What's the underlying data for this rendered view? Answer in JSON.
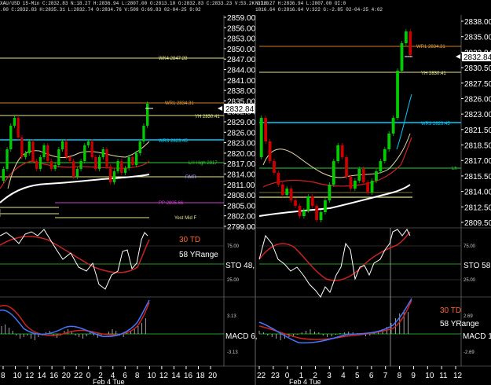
{
  "header": {
    "left_line1": "XAU/USD 15-Min C:2832.83 N:18.27 H:2836.94 L:2807.00 O:2813.10 O:2832.83 C:2833.23 V:53.2K OI:0",
    "left_line2": ".00 C:2832.83 H:2835.31 L:2832.74 O:2834.76 V:509 G:69.83 02-04-25 9:02",
    "right_line1": "N:18.27 H:2836.94 L:2807.00 OI:0",
    "right_line2": "1816.64 O:2816.64 V:322 G:-2.85 02-04-25 4:02"
  },
  "left_chart": {
    "price_ticks": [
      "2859.00",
      "2856.00",
      "2853.00",
      "2850.00",
      "2847.00",
      "2844.00",
      "2841.00",
      "2838.00",
      "2835.00",
      "2832.84",
      "2829.00",
      "2826.00",
      "2823.00",
      "2820.00",
      "2817.00",
      "2814.00",
      "2811.00",
      "2808.00",
      "2805.00",
      "2802.00",
      "2799.00"
    ],
    "current_price": "2832.84",
    "levels": {
      "wk4": "WK4 2847.28",
      "wr1": "WR1 2834.31",
      "yh": "YH 2830.41",
      "wr3": "WR3 2823.45",
      "lh": "LH High 2817",
      "rmr": "RMR",
      "pp": "PP 2805.66",
      "yml": "Yest Mid F"
    },
    "sto_label": "STO 48,",
    "sto_75": "75.00",
    "sto_25": "25.00",
    "td_label": "30 TD",
    "yrange_label": "58 YRange",
    "macd_label": "MACD 6,",
    "macd_top": "3.13",
    "macd_bot": "-3.13",
    "time_ticks": [
      "8",
      "10",
      "12",
      "14",
      "16",
      "20",
      "22",
      "0",
      "2",
      "4",
      "6",
      "8",
      "10",
      "12",
      "14",
      "16",
      "18",
      "20"
    ],
    "date_label": "Feb 4 Tue"
  },
  "right_chart": {
    "price_ticks": [
      "2838.00",
      "2835.00",
      "2832.84",
      "2830.50",
      "2827.50",
      "2826.00",
      "2823.00",
      "2821.50",
      "2818.50",
      "2817.00",
      "2815.50",
      "2814.00",
      "2812.50",
      "2809.50"
    ],
    "current_price": "2832.84",
    "levels": {
      "wr1": "WR1 2834.31",
      "yh": "YH 2830.41",
      "wr3": "WR3 2823.45",
      "lh": "Lh"
    },
    "sto_label": "STO 58",
    "sto_75": "75.00",
    "sto_25": "25.00",
    "td_label": "30 TD",
    "yrange_label": "58 YRange",
    "macd_label": "MACD 1",
    "macd_top": "2.69",
    "macd_bot": "-2.69",
    "time_ticks": [
      "22",
      "23",
      "0",
      "1",
      "2",
      "3",
      "4",
      "5",
      "6",
      "7",
      "8",
      "9",
      "10",
      "11",
      "12"
    ],
    "date_label": "Feb 4 Tue"
  },
  "colors": {
    "up": "#00cc00",
    "down": "#cc0000",
    "level_yellow": "#e6e68c",
    "level_cyan": "#00ccff",
    "level_green": "#33cc33",
    "level_magenta": "#cc44cc",
    "ma_white": "#ffffff",
    "ma_red": "#cc2222"
  }
}
